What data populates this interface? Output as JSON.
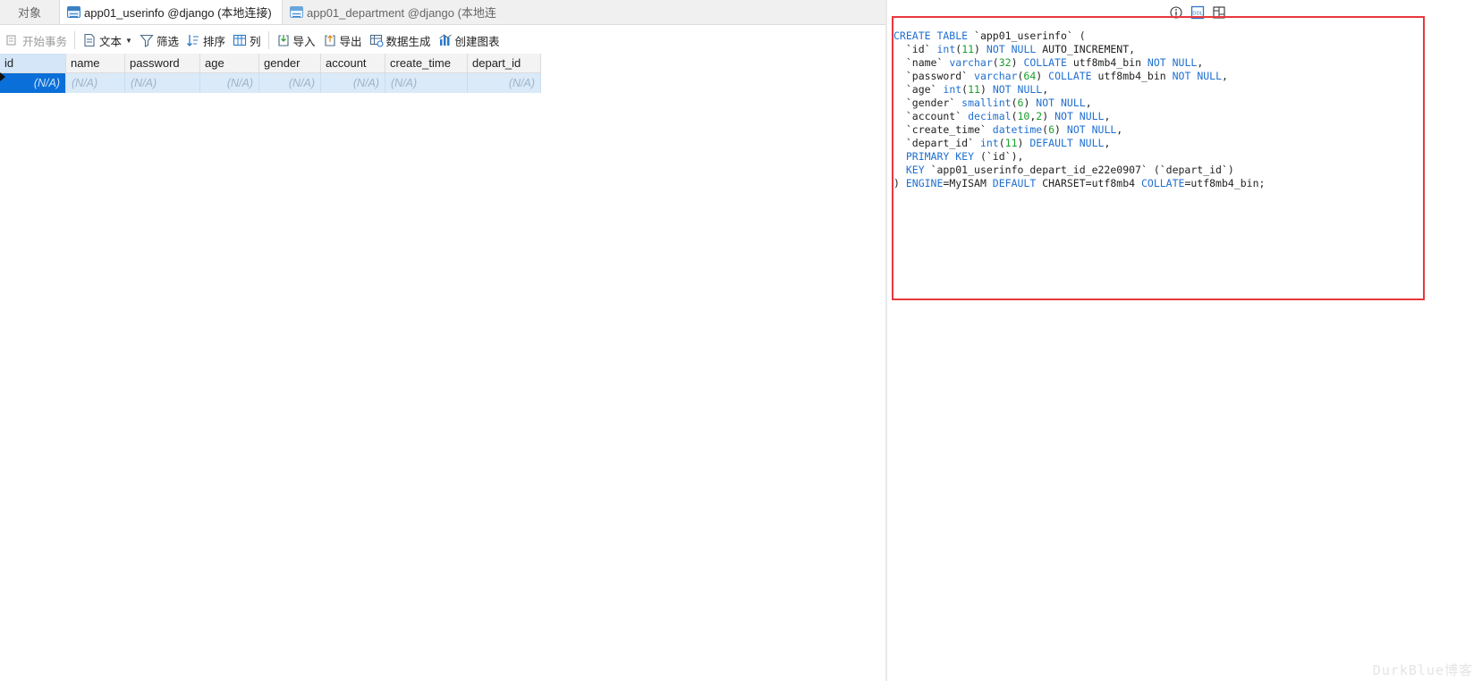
{
  "tabs": {
    "objects": "对象",
    "active": "app01_userinfo @django (本地连接) ...",
    "inactive": "app01_department @django (本地连..."
  },
  "toolbar": {
    "begin_transaction": "开始事务",
    "text": "文本",
    "filter": "筛选",
    "sort": "排序",
    "columns": "列",
    "import": "导入",
    "export": "导出",
    "data_generation": "数据生成",
    "create_chart": "创建图表"
  },
  "grid": {
    "columns": [
      "id",
      "name",
      "password",
      "age",
      "gender",
      "account",
      "create_time",
      "depart_id"
    ],
    "rows": [
      [
        "(N/A)",
        "(N/A)",
        "(N/A)",
        "(N/A)",
        "(N/A)",
        "(N/A)",
        "(N/A)",
        "(N/A)"
      ]
    ]
  },
  "ddl": {
    "lines": [
      [
        [
          "kw",
          "CREATE TABLE"
        ],
        [
          "t",
          " `app01_userinfo` ("
        ]
      ],
      [
        [
          "t",
          "  `id` "
        ],
        [
          "kw",
          "int"
        ],
        [
          "t",
          "("
        ],
        [
          "num",
          "11"
        ],
        [
          "t",
          ") "
        ],
        [
          "kw",
          "NOT NULL"
        ],
        [
          "t",
          " AUTO_INCREMENT,"
        ]
      ],
      [
        [
          "t",
          "  `name` "
        ],
        [
          "kw",
          "varchar"
        ],
        [
          "t",
          "("
        ],
        [
          "num",
          "32"
        ],
        [
          "t",
          ") "
        ],
        [
          "kw",
          "COLLATE"
        ],
        [
          "t",
          " utf8mb4_bin "
        ],
        [
          "kw",
          "NOT NULL"
        ],
        [
          "t",
          ","
        ]
      ],
      [
        [
          "t",
          "  `password` "
        ],
        [
          "kw",
          "varchar"
        ],
        [
          "t",
          "("
        ],
        [
          "num",
          "64"
        ],
        [
          "t",
          ") "
        ],
        [
          "kw",
          "COLLATE"
        ],
        [
          "t",
          " utf8mb4_bin "
        ],
        [
          "kw",
          "NOT NULL"
        ],
        [
          "t",
          ","
        ]
      ],
      [
        [
          "t",
          "  `age` "
        ],
        [
          "kw",
          "int"
        ],
        [
          "t",
          "("
        ],
        [
          "num",
          "11"
        ],
        [
          "t",
          ") "
        ],
        [
          "kw",
          "NOT NULL"
        ],
        [
          "t",
          ","
        ]
      ],
      [
        [
          "t",
          "  `gender` "
        ],
        [
          "kw",
          "smallint"
        ],
        [
          "t",
          "("
        ],
        [
          "num",
          "6"
        ],
        [
          "t",
          ") "
        ],
        [
          "kw",
          "NOT NULL"
        ],
        [
          "t",
          ","
        ]
      ],
      [
        [
          "t",
          "  `account` "
        ],
        [
          "kw",
          "decimal"
        ],
        [
          "t",
          "("
        ],
        [
          "num",
          "10"
        ],
        [
          "t",
          ","
        ],
        [
          "num",
          "2"
        ],
        [
          "t",
          ") "
        ],
        [
          "kw",
          "NOT NULL"
        ],
        [
          "t",
          ","
        ]
      ],
      [
        [
          "t",
          "  `create_time` "
        ],
        [
          "kw",
          "datetime"
        ],
        [
          "t",
          "("
        ],
        [
          "num",
          "6"
        ],
        [
          "t",
          ") "
        ],
        [
          "kw",
          "NOT NULL"
        ],
        [
          "t",
          ","
        ]
      ],
      [
        [
          "t",
          "  `depart_id` "
        ],
        [
          "kw",
          "int"
        ],
        [
          "t",
          "("
        ],
        [
          "num",
          "11"
        ],
        [
          "t",
          ") "
        ],
        [
          "kw",
          "DEFAULT NULL"
        ],
        [
          "t",
          ","
        ]
      ],
      [
        [
          "t",
          "  "
        ],
        [
          "kw",
          "PRIMARY KEY"
        ],
        [
          "t",
          " (`id`),"
        ]
      ],
      [
        [
          "t",
          "  "
        ],
        [
          "kw",
          "KEY"
        ],
        [
          "t",
          " `app01_userinfo_depart_id_e22e0907` (`depart_id`)"
        ]
      ],
      [
        [
          "t",
          ") "
        ],
        [
          "kw",
          "ENGINE"
        ],
        [
          "t",
          "=MyISAM "
        ],
        [
          "kw",
          "DEFAULT"
        ],
        [
          "t",
          " CHARSET=utf8mb4 "
        ],
        [
          "kw",
          "COLLATE"
        ],
        [
          "t",
          "=utf8mb4_bin;"
        ]
      ]
    ]
  },
  "watermark": "DurkBlue博客",
  "colors": {
    "keyword": "#1f6fd0",
    "number": "#18a02a",
    "highlight_border": "#e8383d",
    "selected_cell": "#0a6fd8",
    "row_background": "#dbeaf8"
  }
}
